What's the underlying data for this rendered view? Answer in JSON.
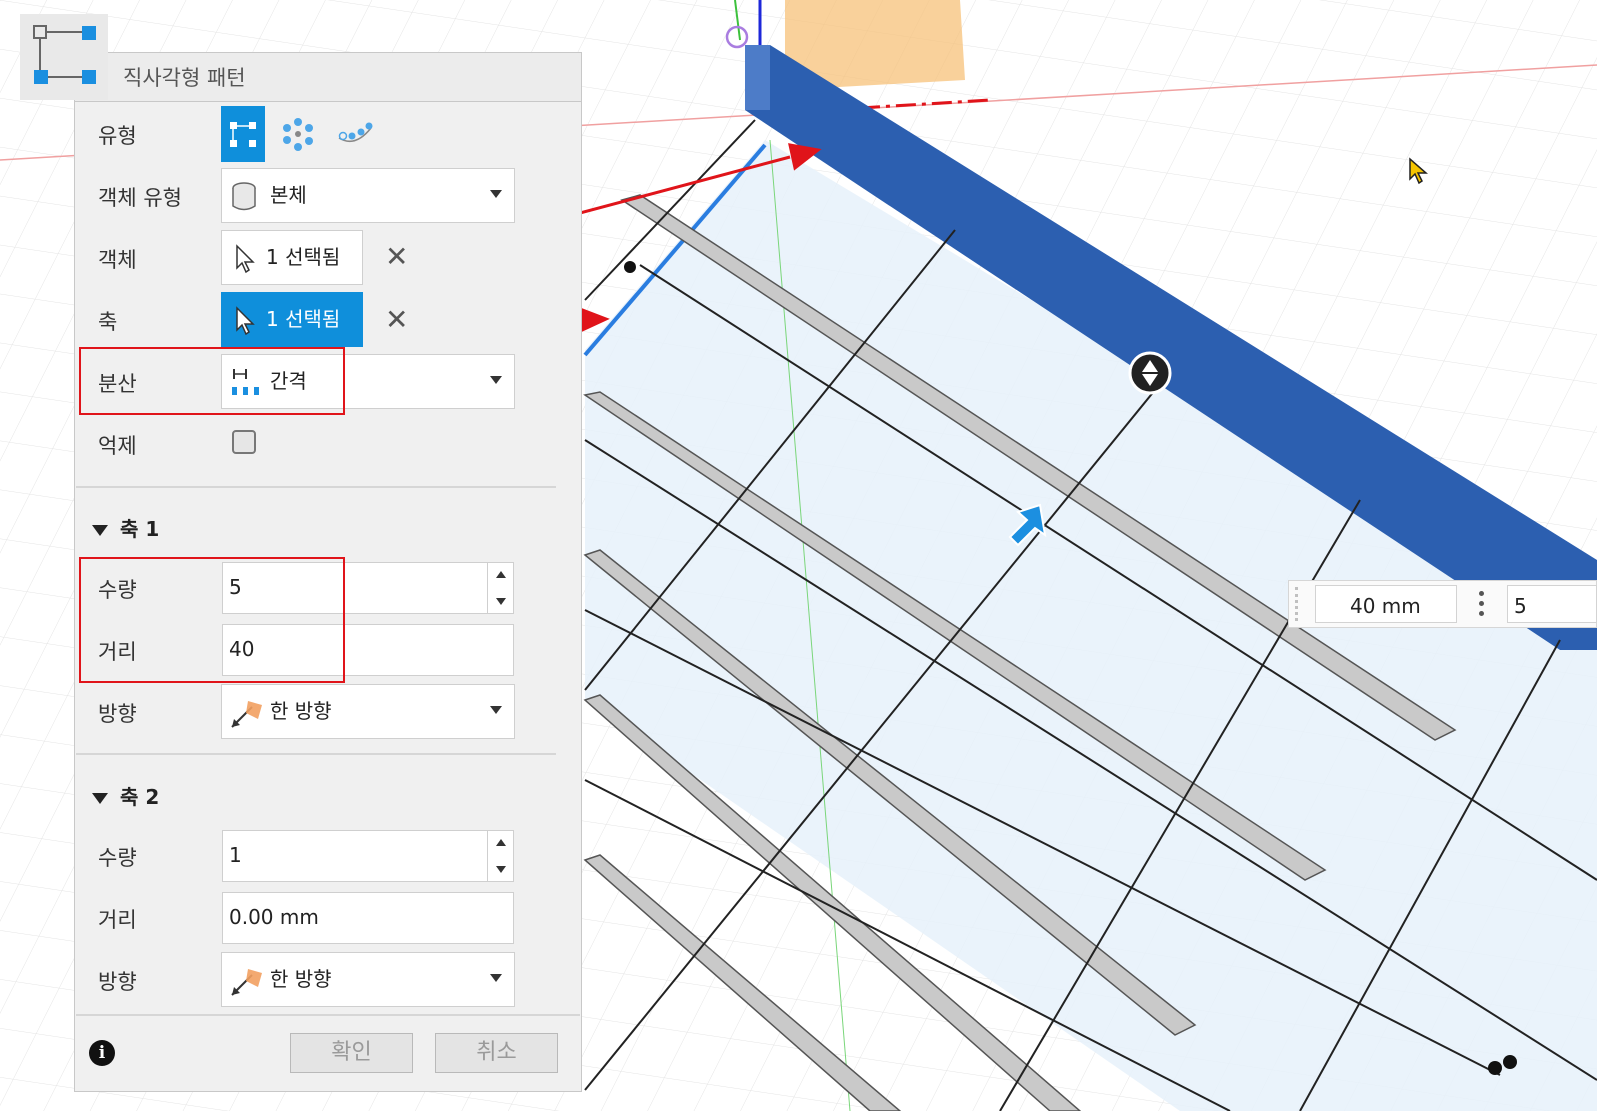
{
  "dialog": {
    "title": "직사각형 패턴",
    "rows": {
      "type_label": "유형",
      "object_type_label": "객체 유형",
      "object_type_value": "본체",
      "objects_label": "객체",
      "objects_value": "1 선택됨",
      "axis_label": "축",
      "axis_value": "1 선택됨",
      "distribution_label": "분산",
      "distribution_value": "간격",
      "suppress_label": "억제"
    },
    "axis1": {
      "header": "축 1",
      "quantity_label": "수량",
      "quantity_value": "5",
      "distance_label": "거리",
      "distance_value": "40",
      "direction_label": "방향",
      "direction_value": "한 방향"
    },
    "axis2": {
      "header": "축 2",
      "quantity_label": "수량",
      "quantity_value": "1",
      "distance_label": "거리",
      "distance_value": "0.00 mm",
      "direction_label": "방향",
      "direction_value": "한 방향"
    },
    "ok_label": "확인",
    "cancel_label": "취소"
  },
  "viewport_hud": {
    "distance_value": "40 mm",
    "quantity_value": "5"
  },
  "colors": {
    "accent": "#0f8fdb",
    "selected_body": "#2c5fb0",
    "annotation": "#e0141a",
    "plane": "#eaf3fb",
    "rail": "#c9c9c9"
  }
}
